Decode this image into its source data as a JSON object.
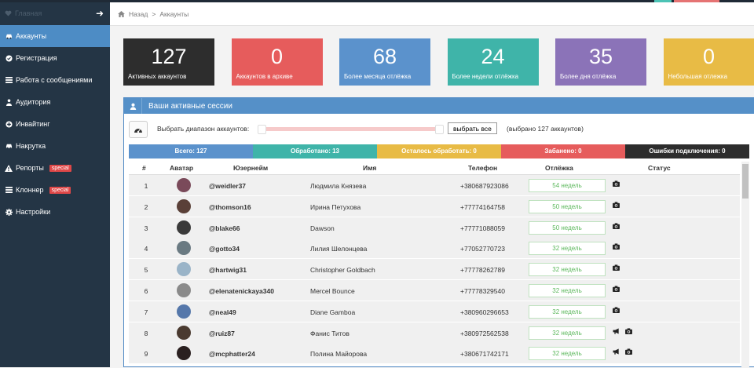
{
  "sidebar": {
    "home_label": "Главная",
    "items": [
      {
        "label": "Аккаунты",
        "icon": "car-icon",
        "active": true
      },
      {
        "label": "Регистрация",
        "icon": "circle-check-icon"
      },
      {
        "label": "Работа с сообщениями",
        "icon": "list-icon"
      },
      {
        "label": "Аудитория",
        "icon": "users-icon"
      },
      {
        "label": "Инвайтинг",
        "icon": "plus-circle-icon"
      },
      {
        "label": "Накрутка",
        "icon": "car-icon"
      },
      {
        "label": "Репорты",
        "icon": "warning-icon",
        "badge": "special"
      },
      {
        "label": "Клоннер",
        "icon": "list-icon",
        "badge": "special"
      },
      {
        "label": "Настройки",
        "icon": "gear-icon"
      }
    ]
  },
  "breadcrumb": {
    "back": "Назад",
    "separator": ">",
    "current": "Аккаунты"
  },
  "tiles": [
    {
      "value": "127",
      "label": "Активных аккаунтов",
      "color": "#2d2d2d"
    },
    {
      "value": "0",
      "label": "Аккаунтов в архиве",
      "color": "#e65c5c"
    },
    {
      "value": "68",
      "label": "Более месяца отлёжка",
      "color": "#5b92cc"
    },
    {
      "value": "24",
      "label": "Более недели отлёжка",
      "color": "#3fb4a9"
    },
    {
      "value": "35",
      "label": "Более дня отлёжка",
      "color": "#8b73b8"
    },
    {
      "value": "0",
      "label": "Небольшая отлежка",
      "color": "#e8bb45"
    }
  ],
  "panel": {
    "title": "Ваши активные сессии",
    "range_label": "Выбрать диапазон аккаунтов:",
    "select_all": "выбрать все",
    "selected_note": "(выбрано 127 аккаунтов)"
  },
  "summary": [
    {
      "label": "Всего:",
      "value": "127",
      "color": "#5b92cc"
    },
    {
      "label": "Обработано:",
      "value": "13",
      "color": "#3fb4a9"
    },
    {
      "label": "Осталось обработать:",
      "value": "0",
      "color": "#e8bb45"
    },
    {
      "label": "Забанено:",
      "value": "0",
      "color": "#e65c5c"
    },
    {
      "label": "Ошибки подключения:",
      "value": "0",
      "color": "#2d2d2d"
    }
  ],
  "table": {
    "headers": {
      "num": "#",
      "avatar": "Аватар",
      "username": "Юзернейм",
      "name": "Имя",
      "phone": "Телефон",
      "away": "Отлёжка",
      "status": "Статус"
    },
    "rows": [
      {
        "num": "1",
        "username": "@weidler37",
        "name": "Людмила Князева",
        "phone": "+380687923086",
        "away": "54 недель",
        "megaphone": false,
        "avatar_color": "#7a4a5a"
      },
      {
        "num": "2",
        "username": "@thomson16",
        "name": "Ирина Петухова",
        "phone": "+77774164758",
        "away": "50 недель",
        "megaphone": false,
        "avatar_color": "#5a4038"
      },
      {
        "num": "3",
        "username": "@blake66",
        "name": "Dawson",
        "phone": "+77771088059",
        "away": "50 недель",
        "megaphone": false,
        "avatar_color": "#3a3a3a"
      },
      {
        "num": "4",
        "username": "@gotto34",
        "name": "Лилия Шелонцева",
        "phone": "+77052770723",
        "away": "32 недель",
        "megaphone": false,
        "avatar_color": "#6a7a82"
      },
      {
        "num": "5",
        "username": "@hartwig31",
        "name": "Christopher Goldbach",
        "phone": "+77778262789",
        "away": "32 недель",
        "megaphone": false,
        "avatar_color": "#9ab4c8"
      },
      {
        "num": "6",
        "username": "@elenatenickaya340",
        "name": "Mercel Bounce",
        "phone": "+77778329540",
        "away": "32 недель",
        "megaphone": false,
        "avatar_color": "#8a8a8a"
      },
      {
        "num": "7",
        "username": "@neal49",
        "name": "Diane Gamboa",
        "phone": "+380960296653",
        "away": "32 недель",
        "megaphone": false,
        "avatar_color": "#5577aa"
      },
      {
        "num": "8",
        "username": "@ruiz87",
        "name": "Фанис Титов",
        "phone": "+380972562538",
        "away": "32 недель",
        "megaphone": true,
        "avatar_color": "#4a3a30"
      },
      {
        "num": "9",
        "username": "@mcphatter24",
        "name": "Полина Майорова",
        "phone": "+380671742171",
        "away": "32 недель",
        "megaphone": true,
        "avatar_color": "#2a2020"
      }
    ]
  }
}
